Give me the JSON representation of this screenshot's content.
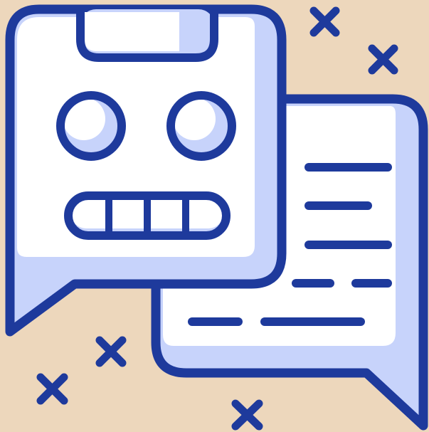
{
  "illustration": {
    "subject_icon": "chatbot-conversation-icon",
    "colors": {
      "background": "#EDD7BC",
      "outline": "#1E3A9C",
      "bubble_fill": "#FFFFFF",
      "shade": "#C7D3FB"
    },
    "icons": {
      "robot": "robot-face-icon",
      "message": "message-lines-icon",
      "sparkle": "cross-sparkle-icon"
    }
  }
}
